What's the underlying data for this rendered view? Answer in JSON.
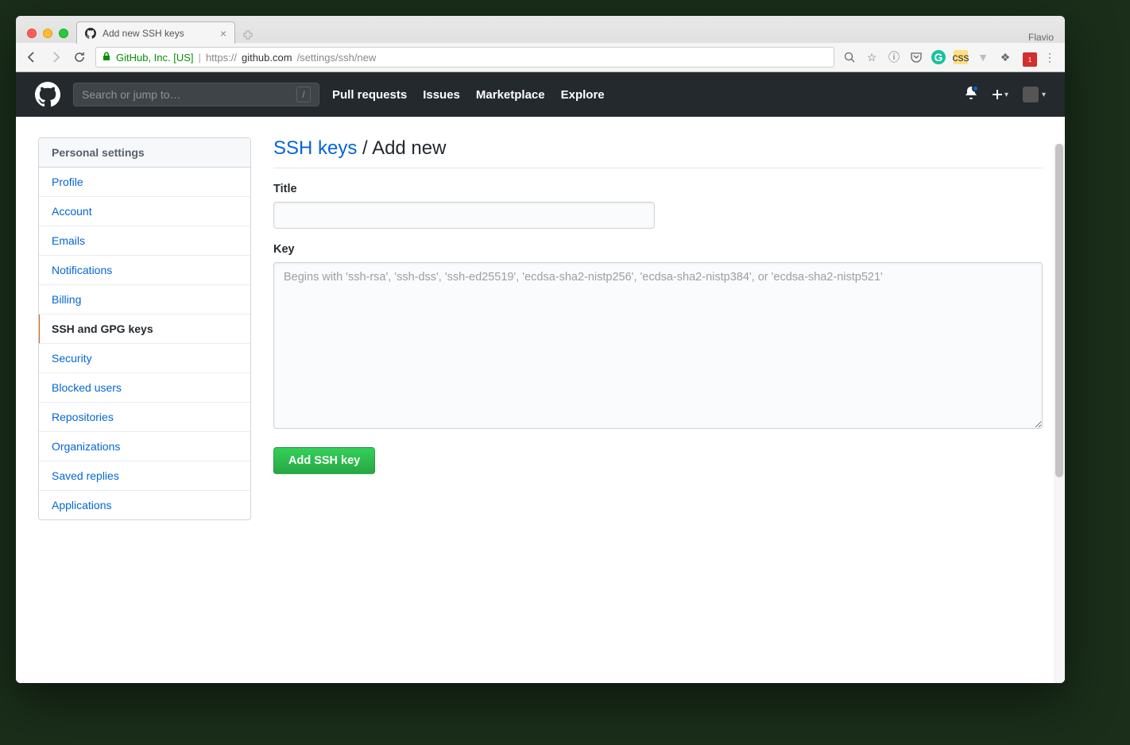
{
  "browser": {
    "profile": "Flavio",
    "tab_title": "Add new SSH keys",
    "ev_cert": "GitHub, Inc. [US]",
    "url_scheme": "https://",
    "url_host": "github.com",
    "url_path": "/settings/ssh/new"
  },
  "header": {
    "search_placeholder": "Search or jump to…",
    "nav": {
      "pull_requests": "Pull requests",
      "issues": "Issues",
      "marketplace": "Marketplace",
      "explore": "Explore"
    }
  },
  "sidebar": {
    "heading": "Personal settings",
    "items": [
      {
        "label": "Profile",
        "active": false
      },
      {
        "label": "Account",
        "active": false
      },
      {
        "label": "Emails",
        "active": false
      },
      {
        "label": "Notifications",
        "active": false
      },
      {
        "label": "Billing",
        "active": false
      },
      {
        "label": "SSH and GPG keys",
        "active": true
      },
      {
        "label": "Security",
        "active": false
      },
      {
        "label": "Blocked users",
        "active": false
      },
      {
        "label": "Repositories",
        "active": false
      },
      {
        "label": "Organizations",
        "active": false
      },
      {
        "label": "Saved replies",
        "active": false
      },
      {
        "label": "Applications",
        "active": false
      }
    ]
  },
  "page": {
    "breadcrumb_link": "SSH keys",
    "breadcrumb_sep": " / ",
    "breadcrumb_current": "Add new",
    "title_label": "Title",
    "title_value": "",
    "key_label": "Key",
    "key_placeholder": "Begins with 'ssh-rsa', 'ssh-dss', 'ssh-ed25519', 'ecdsa-sha2-nistp256', 'ecdsa-sha2-nistp384', or 'ecdsa-sha2-nistp521'",
    "key_value": "",
    "submit_label": "Add SSH key"
  }
}
